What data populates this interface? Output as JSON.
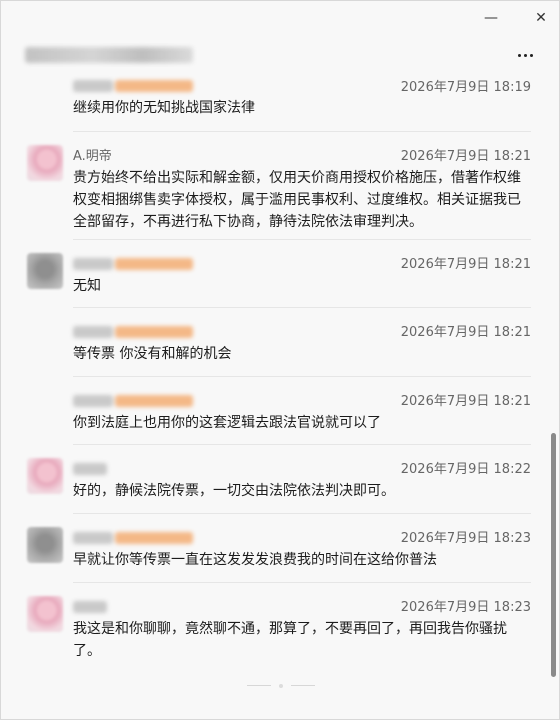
{
  "window": {
    "minimize_icon": "minimize-icon",
    "close_icon": "close-icon",
    "minimize_glyph": "—",
    "close_glyph": "✕"
  },
  "header": {
    "more_icon": "more-icon"
  },
  "messages": [
    {
      "name": "",
      "time": "2026年7月9日 18:19",
      "text": "继续用你的无知挑战国家法律"
    },
    {
      "name": "A.明帝",
      "time": "2026年7月9日 18:21",
      "text": "贵方始终不给出实际和解金额，仅用天价商用授权价格施压，借著作权维权变相捆绑售卖字体授权，属于滥用民事权利、过度维权。相关证据我已全部留存，不再进行私下协商，静待法院依法审理判决。"
    },
    {
      "name": "",
      "time": "2026年7月9日 18:21",
      "text": "无知"
    },
    {
      "name": "",
      "time": "2026年7月9日 18:21",
      "text": "等传票 你没有和解的机会"
    },
    {
      "name": "",
      "time": "2026年7月9日 18:21",
      "text": "你到法庭上也用你的这套逻辑去跟法官说就可以了"
    },
    {
      "name": "",
      "time": "2026年7月9日 18:22",
      "text": "好的，静候法院传票，一切交由法院依法判决即可。"
    },
    {
      "name": "",
      "time": "2026年7月9日 18:23",
      "text": "早就让你等传票一直在这发发发浪费我的时间在这给你普法"
    },
    {
      "name": "",
      "time": "2026年7月9日 18:23",
      "text": "我这是和你聊聊，竟然聊不通，那算了，不要再回了，再回我告你骚扰了。"
    }
  ]
}
